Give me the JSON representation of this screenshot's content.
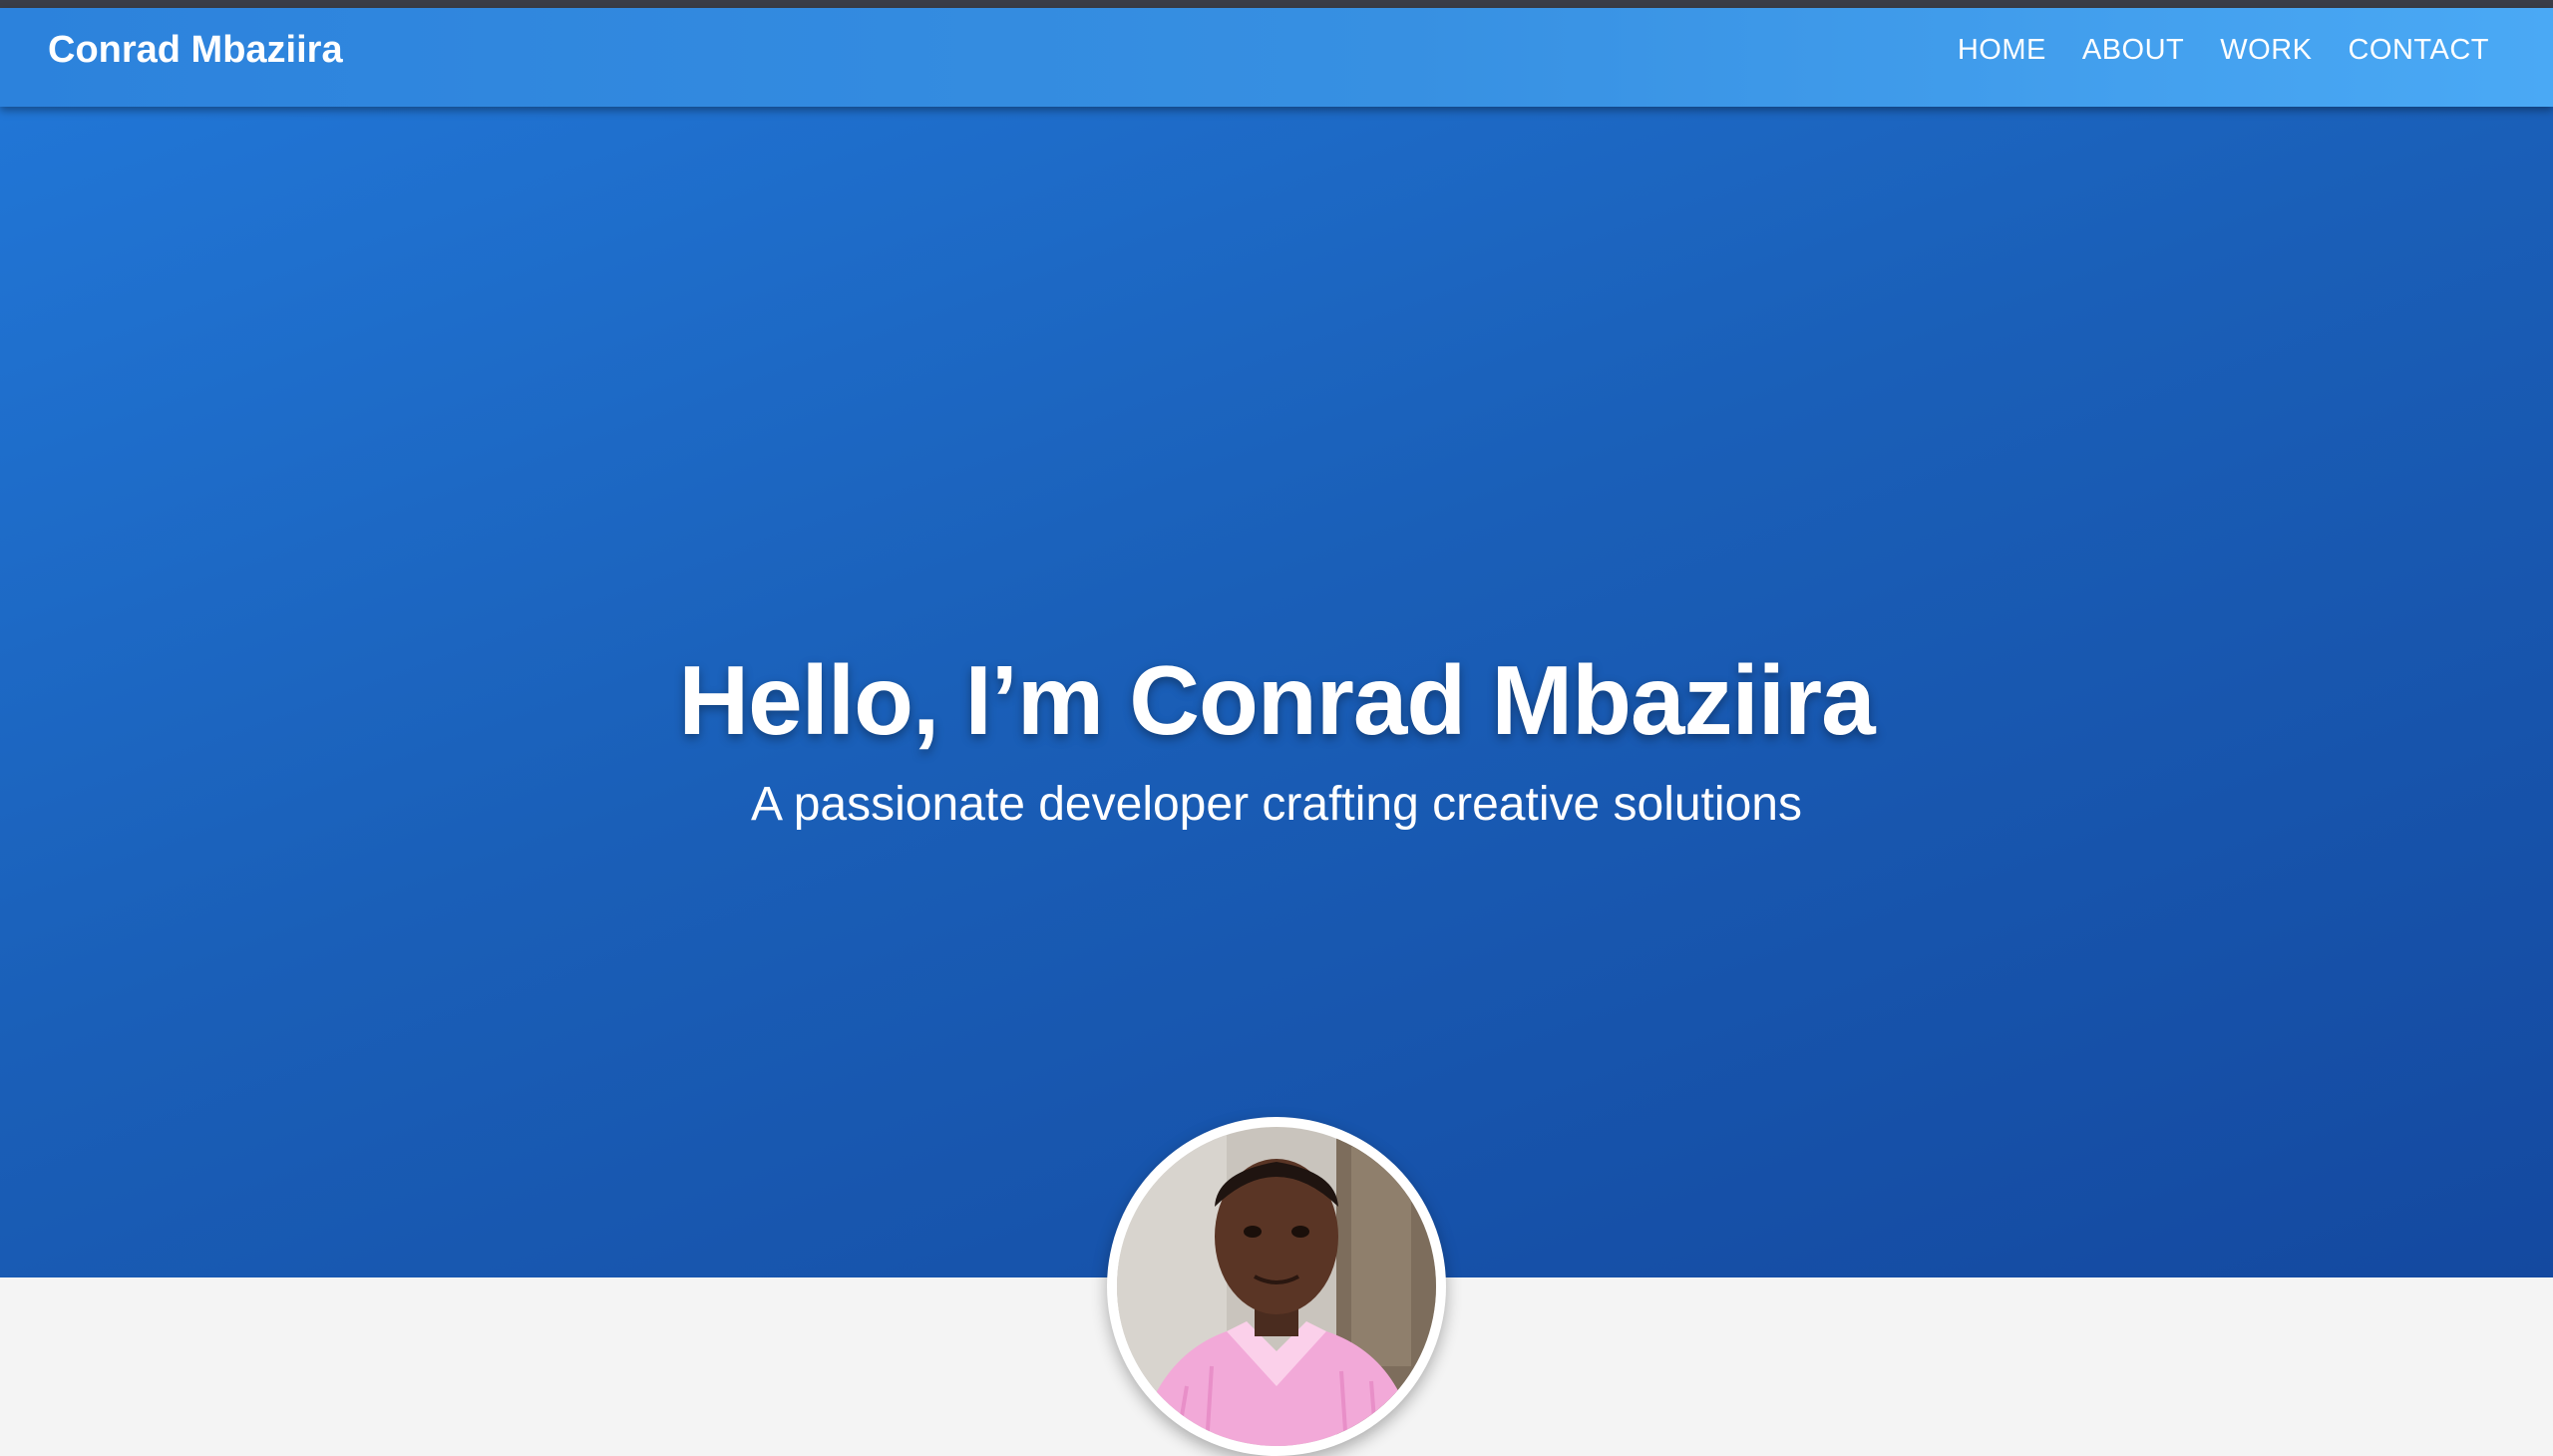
{
  "brand": "Conrad Mbaziira",
  "nav": {
    "items": [
      "HOME",
      "ABOUT",
      "WORK",
      "CONTACT"
    ]
  },
  "hero": {
    "title": "Hello, I’m Conrad Mbaziira",
    "subtitle": "A passionate developer crafting creative solutions"
  },
  "profile_photo": {
    "icon": "profile-photo"
  },
  "colors": {
    "navbar_start": "#2c82dc",
    "navbar_end": "#4aa9f5",
    "hero_start": "#2176d6",
    "hero_end": "#1449a0",
    "page_background": "#f4f4f4",
    "text": "#ffffff"
  }
}
